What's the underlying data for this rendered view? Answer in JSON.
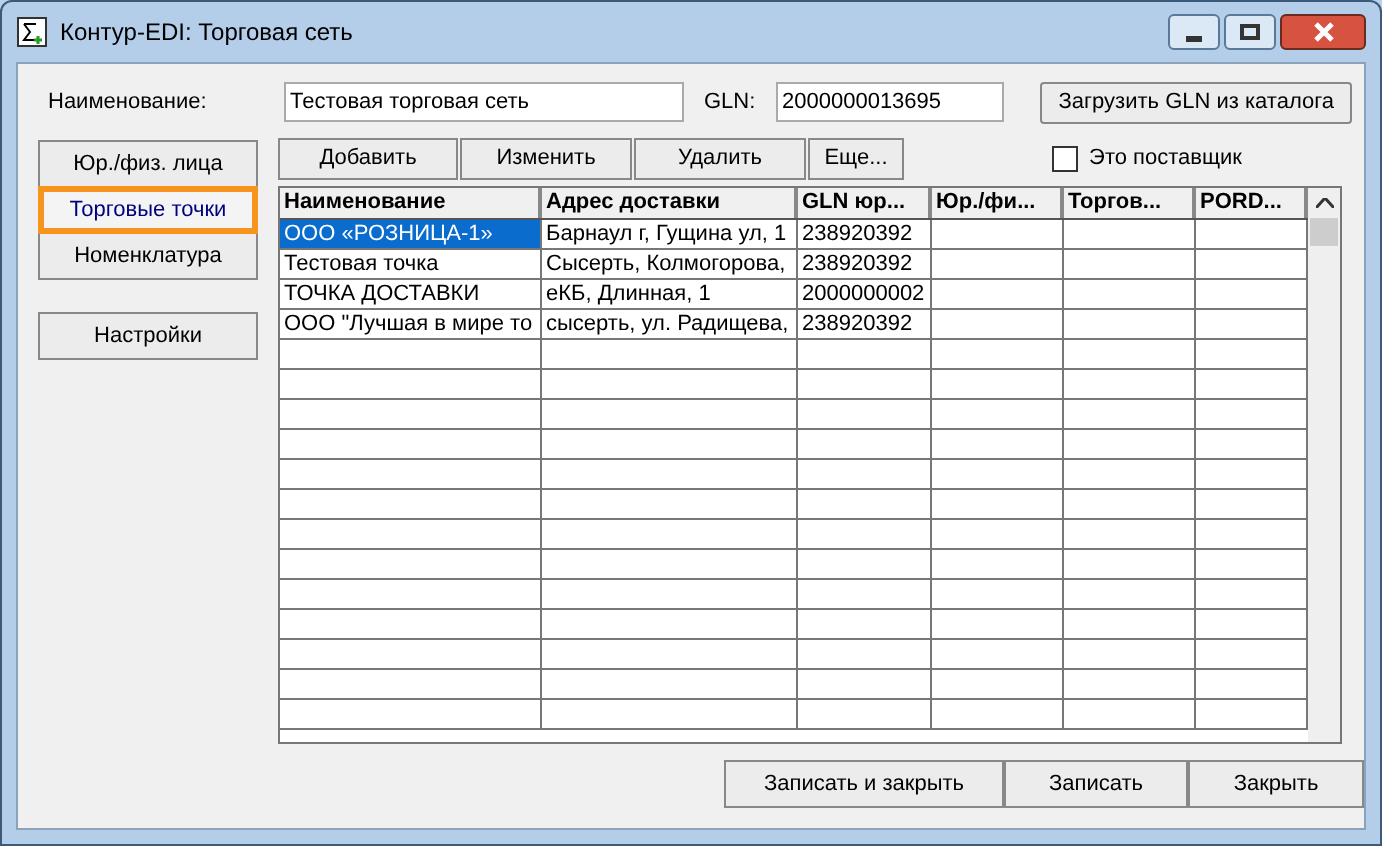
{
  "window": {
    "title": "Контур-EDI: Торговая сеть"
  },
  "name_label": "Наименование:",
  "name_value": "Тестовая торговая сеть",
  "gln_label": "GLN:",
  "gln_value": "2000000013695",
  "load_button": "Загрузить GLN из каталога",
  "side_tabs": [
    {
      "label": "Юр./физ. лица",
      "selected": false
    },
    {
      "label": "Торговые точки",
      "selected": true
    },
    {
      "label": "Номенклатура",
      "selected": false
    }
  ],
  "settings_button": "Настройки",
  "toolbar": [
    "Добавить",
    "Изменить",
    "Удалить",
    "Еще..."
  ],
  "supplier": {
    "label": "Это поставщик",
    "checked": false
  },
  "table": {
    "columns": [
      "Наименование",
      "Адрес доставки",
      "GLN юр...",
      "Юр./фи...",
      "Торгов...",
      "PORD..."
    ],
    "rows": [
      {
        "cells": [
          "ООО «РОЗНИЦА-1»",
          "Барнаул г, Гущина ул, 1",
          "238920392"
        ],
        "selected": true
      },
      {
        "cells": [
          "Тестовая точка",
          "Сысерть, Колмогорова,",
          "238920392"
        ],
        "selected": false
      },
      {
        "cells": [
          "ТОЧКА ДОСТАВКИ",
          "еКБ, Длинная, 1",
          "2000000002"
        ],
        "selected": false
      },
      {
        "cells": [
          "ООО \"Лучшая в мире то",
          "сысерть, ул. Радищева,",
          "238920392"
        ],
        "selected": false
      }
    ]
  },
  "bottom_buttons": [
    "Записать и закрыть",
    "Записать",
    "Закрыть"
  ]
}
